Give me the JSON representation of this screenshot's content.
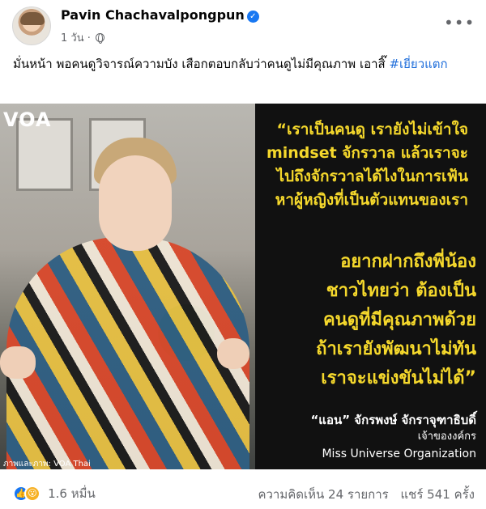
{
  "post": {
    "author": "Pavin Chachavalpongpun",
    "time": "1 วัน",
    "caption_text": "มั่นหน้า พอคนดูวิจารณ์ความบัง เสือกตอบกลับว่าคนดูไม่มีคุณภาพ เอาสิ๊",
    "hashtag": "#เยี่ยวแตก"
  },
  "image": {
    "watermark": "VOA",
    "photo_credit": "ภาพและภาพ: VOA Thai",
    "quote_lines": [
      "“เราเป็นคนดู เรายังไม่เข้าใจ",
      "mindset จักรวาล แล้วเราจะ",
      "ไปถึงจักรวาลได้ไงในการเฟ้น",
      "หาผู้หญิงที่เป็นตัวแทนของเรา"
    ],
    "quote2_lines": [
      "อยากฝากถึงพี่น้อง",
      "ชาวไทยว่า ต้องเป็น",
      "คนดูที่มีคุณภาพด้วย",
      "ถ้าเรายังพัฒนาไม่ทัน",
      "เราจะแข่งขันไม่ได้”"
    ],
    "speaker_name": "“แอน” จักรพงษ์ จักราจุฑาธิบดิ์",
    "speaker_role": "เจ้าของงค์กร",
    "speaker_org": "Miss Universe Organization",
    "quote_color": "#f5d82c"
  },
  "footer": {
    "reaction_count": "1.6 หมื่น",
    "comments": "ความคิดเห็น 24 รายการ",
    "shares": "แชร์ 541 ครั้ง"
  },
  "icons": {
    "verified": "verified-badge-icon",
    "audience": "globe-icon",
    "more": "more-options-icon",
    "like": "like-reaction-icon",
    "wow": "wow-reaction-icon"
  }
}
